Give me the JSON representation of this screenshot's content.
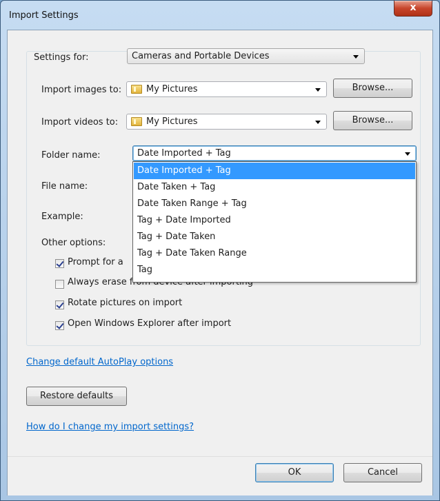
{
  "window": {
    "title": "Import Settings",
    "close_glyph": "x"
  },
  "settings_for": {
    "label": "Settings for:",
    "value": "Cameras and Portable Devices"
  },
  "import_images": {
    "label": "Import images to:",
    "value": "My Pictures",
    "browse_label": "Browse..."
  },
  "import_videos": {
    "label": "Import videos to:",
    "value": "My Pictures",
    "browse_label": "Browse..."
  },
  "folder_name": {
    "label": "Folder name:",
    "value": "Date Imported + Tag",
    "options": [
      "Date Imported + Tag",
      "Date Taken + Tag",
      "Date Taken Range + Tag",
      "Tag + Date Imported",
      "Tag + Date Taken",
      "Tag + Date Taken Range",
      "Tag"
    ]
  },
  "file_name": {
    "label": "File name:"
  },
  "example": {
    "label": "Example:"
  },
  "other_options": {
    "label": "Other options:",
    "prompt": {
      "label": "Prompt for a",
      "checked": true
    },
    "erase": {
      "label": "Always erase from device after importing",
      "checked": false
    },
    "rotate": {
      "label": "Rotate pictures on import",
      "checked": true
    },
    "explorer": {
      "label": "Open Windows Explorer after import",
      "checked": true
    }
  },
  "links": {
    "autoplay": "Change default AutoPlay options",
    "help": "How do I change my import settings?"
  },
  "buttons": {
    "restore": "Restore defaults",
    "ok": "OK",
    "cancel": "Cancel"
  }
}
